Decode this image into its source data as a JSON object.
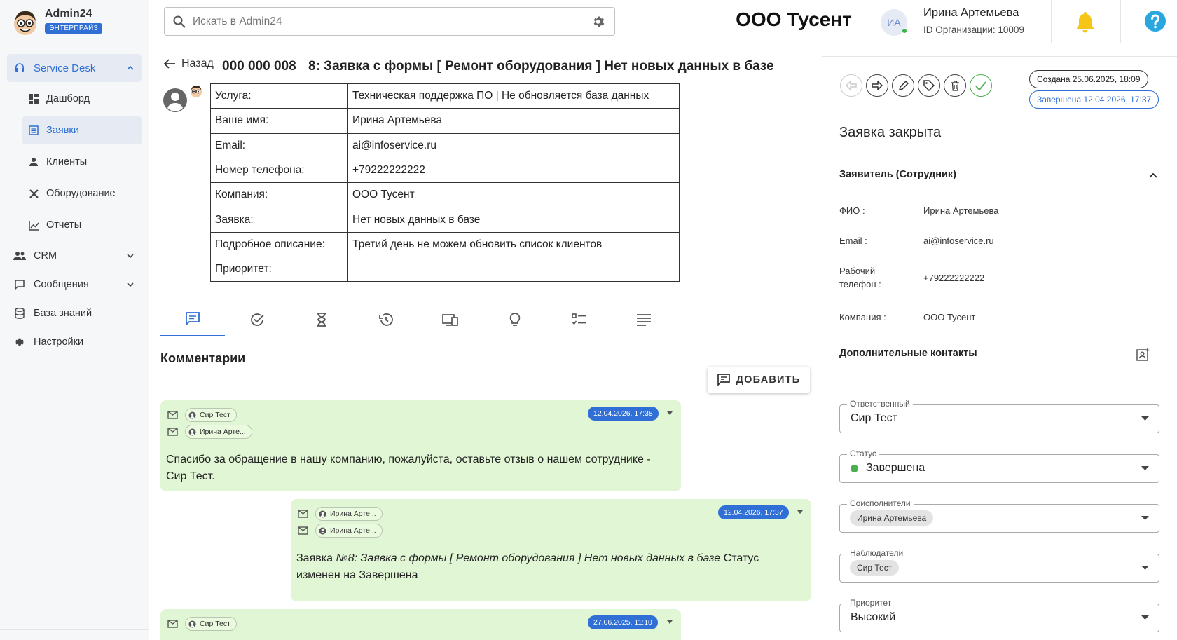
{
  "sidebar": {
    "brand": "Admin24",
    "plan": "ЭНТЕРПРАЙЗ",
    "service_desk": "Service Desk",
    "sub_items": [
      {
        "label": "Дашборд"
      },
      {
        "label": "Заявки"
      },
      {
        "label": "Клиенты"
      },
      {
        "label": "Оборудование"
      },
      {
        "label": "Отчеты"
      }
    ],
    "top_items": [
      {
        "label": "CRM"
      },
      {
        "label": "Сообщения"
      },
      {
        "label": "База знаний"
      },
      {
        "label": "Настройки"
      }
    ]
  },
  "header": {
    "search_placeholder": "Искать в Admin24",
    "org_title": "ООО Тусент",
    "avatar_initials": "ИА",
    "user_name": "Ирина Артемьева",
    "user_org": "ID Организации: 10009"
  },
  "ticket": {
    "back_label": "Назад",
    "number": "000 000 008",
    "title": "8: Заявка с формы [ Ремонт оборудования ] Нет новых данных в базе",
    "rows": [
      {
        "key": "Услуга:",
        "value": "Техническая поддержка ПО | Не обновляется база данных"
      },
      {
        "key": "Ваше имя:",
        "value": "Ирина Артемьева"
      },
      {
        "key": "Email:",
        "value": "ai@infoservice.ru"
      },
      {
        "key": "Номер телефона:",
        "value": "+79222222222"
      },
      {
        "key": "Компания:",
        "value": "ООО Тусент"
      },
      {
        "key": "Заявка:",
        "value": "Нет новых данных в базе"
      },
      {
        "key": "Подробное описание:",
        "value": "Третий день не можем обновить список клиентов"
      },
      {
        "key": "Приоритет:",
        "value": ""
      }
    ]
  },
  "comments_section": {
    "title": "Комментарии",
    "add_label": "ДОБАВИТЬ",
    "comments": [
      {
        "from": "Сир Тест",
        "to": "Ирина Арте...",
        "date": "12.04.2026, 17:38",
        "text": "Спасибо за обращение в нашу компанию, пожалуйста, оставьте отзыв о нашем сотруднике - Сир Тест."
      },
      {
        "from": "Ирина Арте...",
        "to": "Ирина Арте...",
        "date": "12.04.2026, 17:37",
        "text_prefix": "Заявка ",
        "text_italic": "№8: Заявка с формы [ Ремонт оборудования ] Нет новых данных в базе",
        "text_suffix": " Статус изменен на Завершена"
      },
      {
        "from": "Сир Тест",
        "date": "27.06.2025, 11:10"
      }
    ]
  },
  "panel": {
    "created": "Создана 25.06.2025, 18:09",
    "completed": "Завершена 12.04.2026, 17:37",
    "closed_title": "Заявка закрыта",
    "applicant_title": "Заявитель (Сотрудник)",
    "fields": [
      {
        "key": "ФИО :",
        "value": "Ирина Артемьева"
      },
      {
        "key": "Email :",
        "value": "ai@infoservice.ru"
      },
      {
        "key": "Рабочий телефон :",
        "value": "+79222222222"
      },
      {
        "key": "Компания :",
        "value": "ООО Тусент"
      }
    ],
    "extra_contacts": "Дополнительные контакты",
    "selects": {
      "responsible": {
        "label": "Ответственный",
        "value": "Сир Тест"
      },
      "status": {
        "label": "Статус",
        "value": "Завершена"
      },
      "coexec": {
        "label": "Соисполнители",
        "value": "Ирина Артемьева"
      },
      "observers": {
        "label": "Наблюдатели",
        "value": "Сир Тест"
      },
      "priority": {
        "label": "Приоритет",
        "value": "Высокий"
      }
    }
  },
  "colors": {
    "accent": "#2f6fd6",
    "comment_bg": "#e1f6d4",
    "success": "#4caf50",
    "bell": "#f5c518",
    "help": "#29a8e0"
  }
}
